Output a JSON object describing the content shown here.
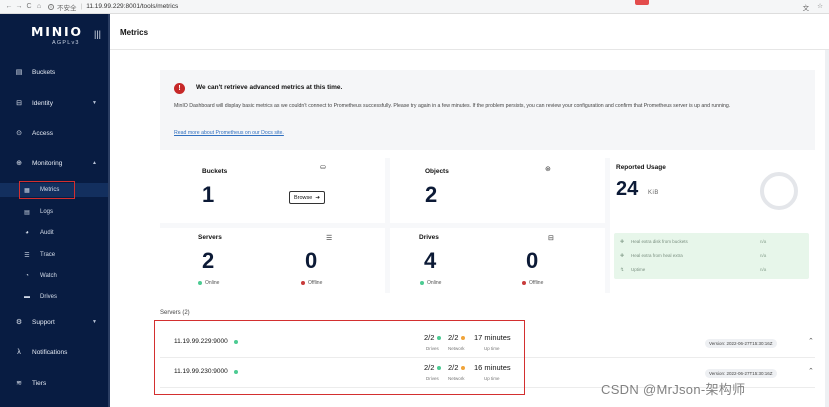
{
  "browser": {
    "insecure_label": "不安全",
    "url": "11.19.99.229:8001/tools/metrics",
    "nav_back": "←",
    "nav_forward": "→",
    "nav_reload": "C",
    "nav_home": "⌂",
    "right_icons": [
      "文",
      "☆"
    ]
  },
  "sidebar": {
    "logo": "MINIO",
    "logo_sub": "AGPLv3",
    "collapse_icon": "|||",
    "items": [
      {
        "label": "Buckets",
        "icon": "bucket-icon",
        "glyph": "▤"
      },
      {
        "label": "Identity",
        "icon": "identity-icon",
        "glyph": "⊟",
        "chevron": "▼"
      },
      {
        "label": "Access",
        "icon": "access-icon",
        "glyph": "⊙"
      },
      {
        "label": "Monitoring",
        "icon": "monitoring-icon",
        "glyph": "⊕",
        "chevron": "▲"
      },
      {
        "label": "Support",
        "icon": "support-icon",
        "glyph": "⚙",
        "chevron": "▼"
      },
      {
        "label": "Notifications",
        "icon": "lambda-icon",
        "glyph": "λ"
      },
      {
        "label": "Tiers",
        "icon": "tiers-icon",
        "glyph": "≋"
      }
    ],
    "sub_items": [
      {
        "label": "Metrics",
        "icon": "metrics-icon",
        "glyph": "▦"
      },
      {
        "label": "Logs",
        "icon": "logs-icon",
        "glyph": "▤"
      },
      {
        "label": "Audit",
        "icon": "audit-icon",
        "glyph": "◕"
      },
      {
        "label": "Trace",
        "icon": "trace-icon",
        "glyph": "☰"
      },
      {
        "label": "Watch",
        "icon": "watch-icon",
        "glyph": "◔"
      },
      {
        "label": "Drives",
        "icon": "drives-icon",
        "glyph": "▬"
      }
    ]
  },
  "header": {
    "title": "Metrics"
  },
  "alert": {
    "title": "We can't retrieve advanced metrics at this time.",
    "body": "MinIO Dashboard will display basic metrics as we couldn't connect to Prometheus successfully. Please try again in a few minutes. If the problem persists, you can review your configuration and confirm that Prometheus server is up and running.",
    "link": "Read more about Prometheus on our Docs site."
  },
  "stats": {
    "buckets": {
      "label": "Buckets",
      "value": "1",
      "browse": "Browse",
      "browse_arrow": "➔",
      "icon_glyph": "⛀"
    },
    "objects": {
      "label": "Objects",
      "value": "2",
      "icon_glyph": "⊛"
    },
    "servers": {
      "label": "Servers",
      "online": "2",
      "offline": "0",
      "online_label": "Online",
      "offline_label": "Offline",
      "icon_glyph": "☰"
    },
    "drives": {
      "label": "Drives",
      "online": "4",
      "offline": "0",
      "online_label": "Online",
      "offline_label": "Offline",
      "icon_glyph": "⊟"
    },
    "usage": {
      "label": "Reported Usage",
      "value": "24",
      "unit": "KiB",
      "health": [
        {
          "label": "Heal extra disk from buckets",
          "value": "n/a"
        },
        {
          "label": "Heal extra from heal extra",
          "value": "n/a"
        },
        {
          "label": "Uptime",
          "value": "n/a"
        }
      ]
    }
  },
  "servers": {
    "heading": "Servers (2)",
    "rows": [
      {
        "address": "11.19.99.229:9000",
        "drives": "2/2",
        "network": "2/2",
        "uptime": "17 minutes",
        "drives_label": "Drives",
        "network_label": "Network",
        "uptime_label": "Up time",
        "version": "Version: 2022-06-27T15:30:16Z"
      },
      {
        "address": "11.19.99.230:9000",
        "drives": "2/2",
        "network": "2/2",
        "uptime": "16 minutes",
        "drives_label": "Drives",
        "network_label": "Network",
        "uptime_label": "Up time",
        "version": "Version: 2022-06-27T15:30:16Z"
      }
    ]
  },
  "watermark": "CSDN @MrJson-架构师",
  "colors": {
    "sidebar_bg": "#081c42",
    "online": "#4ccb92",
    "offline": "#c83b3b",
    "network": "#f0a43a",
    "highlight": "#d32f2f"
  }
}
